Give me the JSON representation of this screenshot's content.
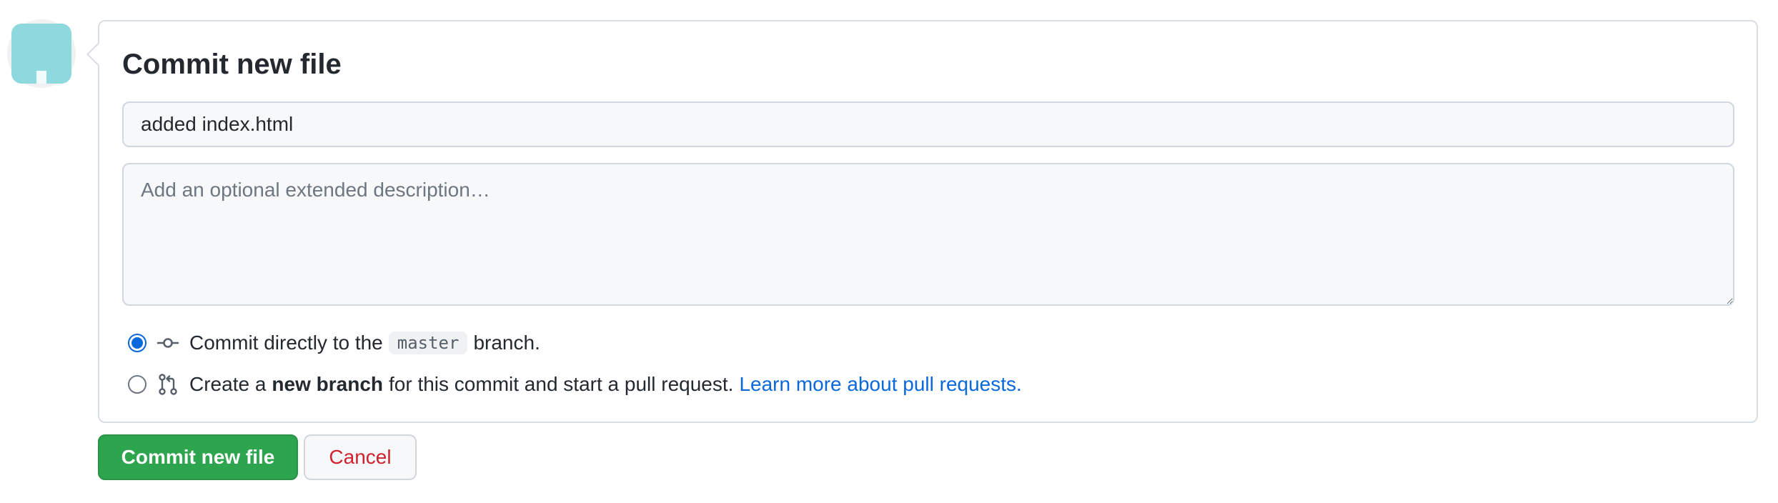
{
  "colors": {
    "primary_button": "#2da44e",
    "link": "#0969da",
    "danger": "#cf222e",
    "avatar": "#8dd9de"
  },
  "avatar": {
    "icon": "identicon-avatar"
  },
  "commit_form": {
    "title": "Commit new file",
    "summary": {
      "value": "added index.html"
    },
    "description": {
      "value": "",
      "placeholder": "Add an optional extended description…"
    },
    "options": {
      "direct": {
        "selected": true,
        "icon": "git-commit-icon",
        "text_before": "Commit directly to the",
        "branch": "master",
        "text_after": "branch."
      },
      "new_branch": {
        "selected": false,
        "icon": "git-pull-request-icon",
        "text_before": "Create a",
        "bold": "new branch",
        "text_after": "for this commit and start a pull request.",
        "link": "Learn more about pull requests."
      }
    }
  },
  "buttons": {
    "commit": "Commit new file",
    "cancel": "Cancel"
  }
}
